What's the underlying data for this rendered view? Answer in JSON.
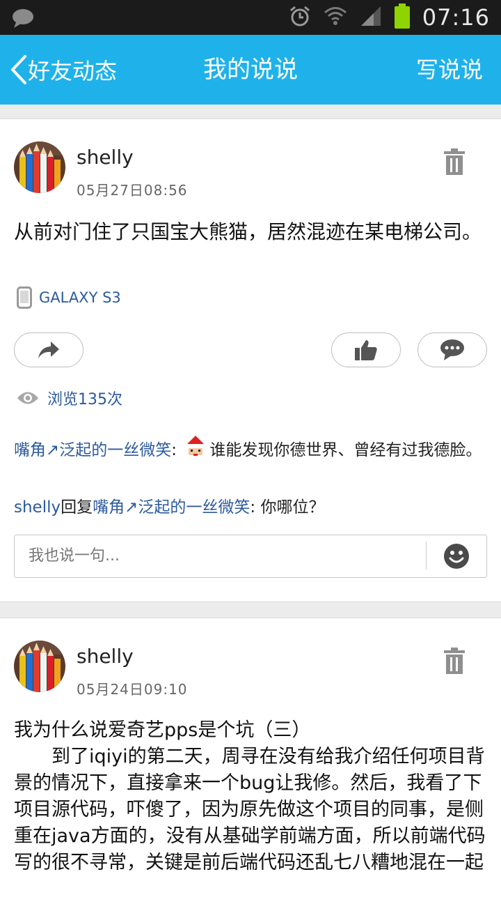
{
  "status_bar": {
    "time": "07:16",
    "icons": [
      "message-icon",
      "alarm-icon",
      "wifi-icon",
      "signal-icon",
      "battery-icon"
    ]
  },
  "nav": {
    "back_label": "好友动态",
    "title": "我的说说",
    "action_label": "写说说"
  },
  "posts": [
    {
      "user": "shelly",
      "date": "05月27日08:56",
      "content": "从前对门住了只国宝大熊猫，居然混迹在某电梯公司。",
      "device": "GALAXY S3",
      "views": "浏览135次",
      "comments": [
        {
          "author": "嘴角↗泛起的一丝微笑",
          "sep": ":",
          "emoji": "santa-emoji",
          "text": "谁能发现你德世界、曾经有过我德脸。"
        },
        {
          "author": "shelly",
          "reply_word": "回复",
          "reply_to": "嘴角↗泛起的一丝微笑",
          "sep": ":",
          "text": " 你哪位？"
        }
      ],
      "reply_placeholder": "我也说一句..."
    },
    {
      "user": "shelly",
      "date": "05月24日09:10",
      "content_title": "我为什么说爱奇艺pps是个坑（三）",
      "content_body": "　　到了iqiyi的第二天，周寻在没有给我介绍任何项目背景的情况下，直接拿来一个bug让我修。然后，我看了下项目源代码，吓傻了，因为原先做这个项目的同事，是侧重在java方面的，没有从基础学前端方面，所以前端代码写的很不寻常，关键是前后端代码还乱七八糟地混在一起"
    }
  ],
  "colors": {
    "nav_bg": "#1fb2ea",
    "link": "#2b5a9e",
    "status_bg": "#1b1b1b",
    "battery": "#8fd400"
  }
}
